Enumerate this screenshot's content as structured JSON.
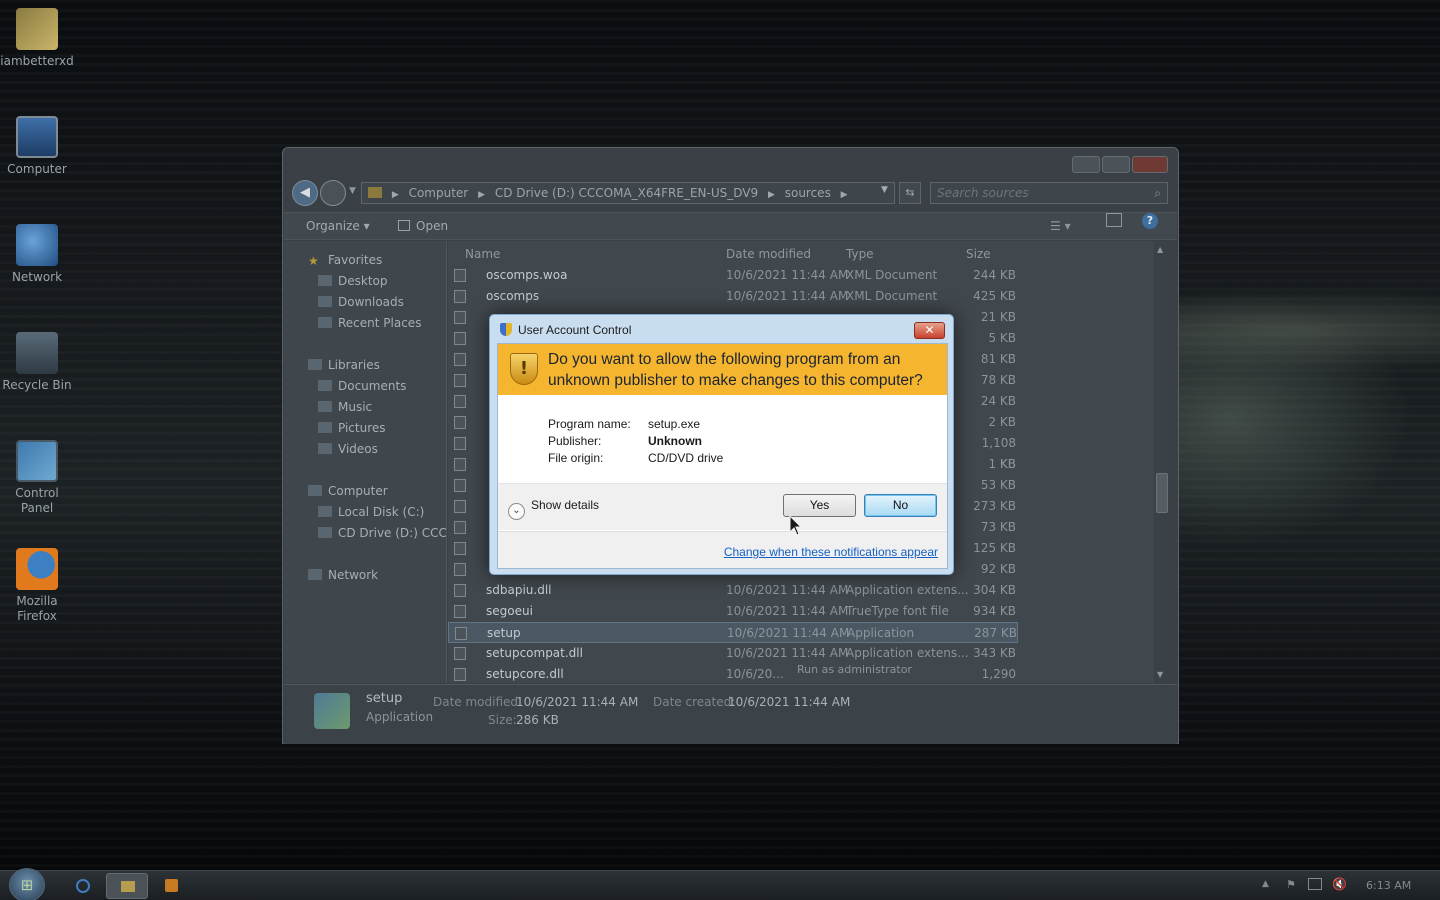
{
  "desktop": {
    "icons": [
      {
        "label": "iambetterxd",
        "icon": "user-folder-icon"
      },
      {
        "label": "Computer",
        "icon": "computer-icon"
      },
      {
        "label": "Network",
        "icon": "network-icon"
      },
      {
        "label": "Recycle Bin",
        "icon": "recycle-bin-icon"
      },
      {
        "label": "Control Panel",
        "icon": "control-panel-icon"
      },
      {
        "label": "Mozilla Firefox",
        "icon": "firefox-icon"
      }
    ]
  },
  "explorer": {
    "breadcrumb": [
      "Computer",
      "CD Drive (D:) CCCOMA_X64FRE_EN-US_DV9",
      "sources"
    ],
    "search_placeholder": "Search sources",
    "toolbar": {
      "organize": "Organize ▾",
      "open": "Open"
    },
    "nav": {
      "favorites": "Favorites",
      "desktop": "Desktop",
      "downloads": "Downloads",
      "recent": "Recent Places",
      "libraries": "Libraries",
      "documents": "Documents",
      "music": "Music",
      "pictures": "Pictures",
      "videos": "Videos",
      "computer": "Computer",
      "local_disk": "Local Disk (C:)",
      "cd_drive": "CD Drive (D:) CCCOMA",
      "network": "Network"
    },
    "columns": {
      "name": "Name",
      "date": "Date modified",
      "type": "Type",
      "size": "Size"
    },
    "files": [
      {
        "name": "oscomps.woa",
        "date": "10/6/2021 11:44 AM",
        "type": "XML Document",
        "size": "244 KB"
      },
      {
        "name": "oscomps",
        "date": "10/6/2021 11:44 AM",
        "type": "XML Document",
        "size": "425 KB"
      },
      {
        "name": "",
        "date": "",
        "type": "",
        "size": "21 KB"
      },
      {
        "name": "",
        "date": "",
        "type": "",
        "size": "5 KB"
      },
      {
        "name": "",
        "date": "",
        "type": "",
        "size": "81 KB"
      },
      {
        "name": "",
        "date": "",
        "type": "",
        "size": "78 KB"
      },
      {
        "name": "",
        "date": "",
        "type": "",
        "size": "24 KB"
      },
      {
        "name": "",
        "date": "",
        "type": "",
        "size": "2 KB"
      },
      {
        "name": "",
        "date": "",
        "type": "",
        "size": "1,108 KB"
      },
      {
        "name": "",
        "date": "",
        "type": "",
        "size": "1 KB"
      },
      {
        "name": "",
        "date": "",
        "type": "",
        "size": "53 KB"
      },
      {
        "name": "",
        "date": "",
        "type": "",
        "size": "273 KB"
      },
      {
        "name": "",
        "date": "",
        "type": "",
        "size": "73 KB"
      },
      {
        "name": "",
        "date": "",
        "type": "",
        "size": "125 KB"
      },
      {
        "name": "",
        "date": "",
        "type": "",
        "size": "92 KB"
      },
      {
        "name": "sdbapiu.dll",
        "date": "10/6/2021 11:44 AM",
        "type": "Application extens...",
        "size": "304 KB"
      },
      {
        "name": "segoeui",
        "date": "10/6/2021 11:44 AM",
        "type": "TrueType font file",
        "size": "934 KB"
      },
      {
        "name": "setup",
        "date": "10/6/2021 11:44 AM",
        "type": "Application",
        "size": "287 KB"
      },
      {
        "name": "setupcompat.dll",
        "date": "10/6/2021 11:44 AM",
        "type": "Application extens...",
        "size": "343 KB"
      },
      {
        "name": "setupcore.dll",
        "date": "10/6/20...",
        "type": "",
        "size": "1,290 KB"
      }
    ],
    "context_hint": "Run as administrator",
    "details": {
      "name": "setup",
      "type": "Application",
      "modified_label": "Date modified:",
      "modified_value": "10/6/2021 11:44 AM",
      "size_label": "Size:",
      "size_value": "286 KB",
      "created_label": "Date created:",
      "created_value": "10/6/2021 11:44 AM"
    }
  },
  "uac": {
    "title": "User Account Control",
    "close": "✕",
    "question": "Do you want to allow the following program from an unknown publisher to make changes to this computer?",
    "labels": {
      "program": "Program name:",
      "publisher": "Publisher:",
      "origin": "File origin:"
    },
    "values": {
      "program": "setup.exe",
      "publisher": "Unknown",
      "origin": "CD/DVD drive"
    },
    "show_details": "Show details",
    "yes": "Yes",
    "no": "No",
    "change_link": "Change when these notifications appear"
  },
  "taskbar": {
    "clock": "6:13 AM"
  }
}
